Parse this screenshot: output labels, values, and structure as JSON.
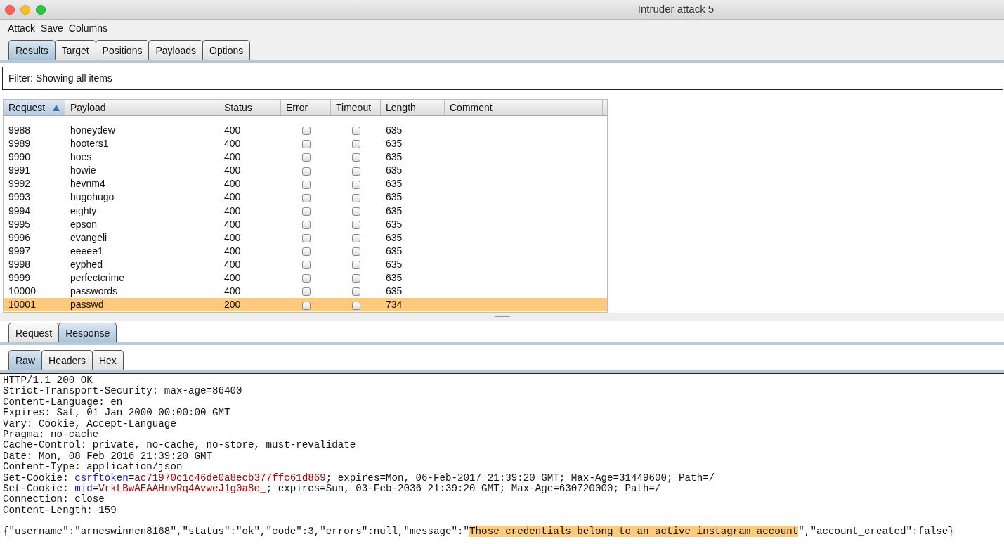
{
  "window": {
    "title": "Intruder attack 5"
  },
  "menu": [
    "Attack",
    "Save",
    "Columns"
  ],
  "tabs": [
    {
      "label": "Results",
      "selected": true
    },
    {
      "label": "Target",
      "selected": false
    },
    {
      "label": "Positions",
      "selected": false
    },
    {
      "label": "Payloads",
      "selected": false
    },
    {
      "label": "Options",
      "selected": false
    }
  ],
  "filter": "Filter: Showing all items",
  "table": {
    "columns": [
      {
        "label": "Request",
        "sorted": true
      },
      {
        "label": "Payload"
      },
      {
        "label": "Status"
      },
      {
        "label": "Error"
      },
      {
        "label": "Timeout"
      },
      {
        "label": "Length"
      },
      {
        "label": "Comment"
      }
    ],
    "rows": [
      {
        "request": "9988",
        "payload": "honeydew",
        "status": "400",
        "error": false,
        "timeout": false,
        "length": "635",
        "selected": false
      },
      {
        "request": "9989",
        "payload": "hooters1",
        "status": "400",
        "error": false,
        "timeout": false,
        "length": "635",
        "selected": false
      },
      {
        "request": "9990",
        "payload": "hoes",
        "status": "400",
        "error": false,
        "timeout": false,
        "length": "635",
        "selected": false
      },
      {
        "request": "9991",
        "payload": "howie",
        "status": "400",
        "error": false,
        "timeout": false,
        "length": "635",
        "selected": false
      },
      {
        "request": "9992",
        "payload": "hevnm4",
        "status": "400",
        "error": false,
        "timeout": false,
        "length": "635",
        "selected": false
      },
      {
        "request": "9993",
        "payload": "hugohugo",
        "status": "400",
        "error": false,
        "timeout": false,
        "length": "635",
        "selected": false
      },
      {
        "request": "9994",
        "payload": "eighty",
        "status": "400",
        "error": false,
        "timeout": false,
        "length": "635",
        "selected": false
      },
      {
        "request": "9995",
        "payload": "epson",
        "status": "400",
        "error": false,
        "timeout": false,
        "length": "635",
        "selected": false
      },
      {
        "request": "9996",
        "payload": "evangeli",
        "status": "400",
        "error": false,
        "timeout": false,
        "length": "635",
        "selected": false
      },
      {
        "request": "9997",
        "payload": "eeeee1",
        "status": "400",
        "error": false,
        "timeout": false,
        "length": "635",
        "selected": false
      },
      {
        "request": "9998",
        "payload": "eyphed",
        "status": "400",
        "error": false,
        "timeout": false,
        "length": "635",
        "selected": false
      },
      {
        "request": "9999",
        "payload": "perfectcrime",
        "status": "400",
        "error": false,
        "timeout": false,
        "length": "635",
        "selected": false
      },
      {
        "request": "10000",
        "payload": "passwords",
        "status": "400",
        "error": false,
        "timeout": false,
        "length": "635",
        "selected": false
      },
      {
        "request": "10001",
        "payload": "passwd",
        "status": "200",
        "error": false,
        "timeout": false,
        "length": "734",
        "selected": true
      }
    ]
  },
  "message_tabs": [
    {
      "label": "Request",
      "selected": false
    },
    {
      "label": "Response",
      "selected": true
    }
  ],
  "view_tabs": [
    {
      "label": "Raw",
      "selected": true
    },
    {
      "label": "Headers",
      "selected": false
    },
    {
      "label": "Hex",
      "selected": false
    }
  ],
  "response_lines": [
    {
      "segments": [
        {
          "kind": "plain",
          "text": "HTTP/1.1 200 OK"
        }
      ]
    },
    {
      "segments": [
        {
          "kind": "plain",
          "text": "Strict-Transport-Security: max-age=86400"
        }
      ]
    },
    {
      "segments": [
        {
          "kind": "plain",
          "text": "Content-Language: en"
        }
      ]
    },
    {
      "segments": [
        {
          "kind": "plain",
          "text": "Expires: Sat, 01 Jan 2000 00:00:00 GMT"
        }
      ]
    },
    {
      "segments": [
        {
          "kind": "plain",
          "text": "Vary: Cookie, Accept-Language"
        }
      ]
    },
    {
      "segments": [
        {
          "kind": "plain",
          "text": "Pragma: no-cache"
        }
      ]
    },
    {
      "segments": [
        {
          "kind": "plain",
          "text": "Cache-Control: private, no-cache, no-store, must-revalidate"
        }
      ]
    },
    {
      "segments": [
        {
          "kind": "plain",
          "text": "Date: Mon, 08 Feb 2016 21:39:20 GMT"
        }
      ]
    },
    {
      "segments": [
        {
          "kind": "plain",
          "text": "Content-Type: application/json"
        }
      ]
    },
    {
      "segments": [
        {
          "kind": "plain",
          "text": "Set-Cookie: "
        },
        {
          "kind": "name",
          "text": "csrftoken"
        },
        {
          "kind": "plain",
          "text": "="
        },
        {
          "kind": "value",
          "text": "ac71970c1c46de0a8ecb377ffc61d869"
        },
        {
          "kind": "plain",
          "text": "; expires=Mon, 06-Feb-2017 21:39:20 GMT; Max-Age=31449600; Path=/"
        }
      ]
    },
    {
      "segments": [
        {
          "kind": "plain",
          "text": "Set-Cookie: "
        },
        {
          "kind": "name",
          "text": "mid"
        },
        {
          "kind": "plain",
          "text": "="
        },
        {
          "kind": "value",
          "text": "VrkLBwAEAAHnvRq4AvweJ1g0a8e_"
        },
        {
          "kind": "plain",
          "text": "; expires=Sun, 03-Feb-2036 21:39:20 GMT; Max-Age=630720000; Path=/"
        }
      ]
    },
    {
      "segments": [
        {
          "kind": "plain",
          "text": "Connection: close"
        }
      ]
    },
    {
      "segments": [
        {
          "kind": "plain",
          "text": "Content-Length: 159"
        }
      ]
    },
    {
      "spaced": true,
      "segments": [
        {
          "kind": "plain",
          "text": "{\"username\":\"arneswinnen8168\",\"status\":\"ok\",\"code\":3,\"errors\":null,\"message\":\""
        },
        {
          "kind": "highlight",
          "text": "Those credentials belong to an active instagram account"
        },
        {
          "kind": "plain",
          "text": "\",\"account_created\":false}"
        }
      ]
    }
  ]
}
